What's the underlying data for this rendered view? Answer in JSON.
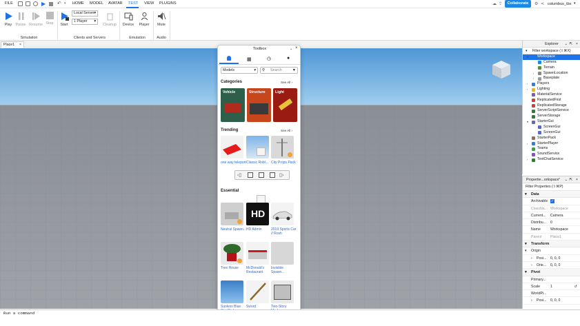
{
  "menu": {
    "file": "FILE",
    "home": "HOME",
    "model": "MODEL",
    "avatar": "AVATAR",
    "test": "TEST",
    "view": "VIEW",
    "plugins": "PLUGINS"
  },
  "topright": {
    "collaborate": "Collaborate",
    "user": "columbus_tbx"
  },
  "ribbon": {
    "play": "Play",
    "pause": "Pause",
    "resume": "Resume",
    "stop": "Stop",
    "group_simulation": "Simulation",
    "start": "Start",
    "server_select": "Local Server",
    "players_select": "1 Player",
    "cleanup": "Cleanup",
    "group_clients": "Clients and Servers",
    "device": "Device",
    "player": "Player",
    "group_emulation": "Emulation",
    "mute": "Mute",
    "group_audio": "Audio"
  },
  "doc_tab": "Place1",
  "command_bar": "Run a command",
  "toolbox": {
    "title": "Toolbox",
    "category_select": "Models",
    "search_placeholder": "Search",
    "categories": {
      "title": "Categories",
      "see_all": "See All",
      "items": [
        {
          "label": "Vehicle",
          "color": "#2e5f4a"
        },
        {
          "label": "Structure",
          "color": "#c8461c"
        },
        {
          "label": "Light",
          "color": "#9a1b12"
        }
      ]
    },
    "trending": {
      "title": "Trending",
      "see_all": "See All",
      "items": [
        {
          "label": "one way teleport"
        },
        {
          "label": "Classic Robl..."
        },
        {
          "label": "City Props Pack"
        }
      ]
    },
    "essential": {
      "title": "Essential",
      "items": [
        {
          "label": "Neutral Spawn..."
        },
        {
          "label": "HD Admin"
        },
        {
          "label": "2019 Sports Car // Rosh"
        },
        {
          "label": "Tree House"
        },
        {
          "label": "McDonald's Restaurant"
        },
        {
          "label": "Invisible Spawn..."
        },
        {
          "label": "Sunless Blue Sky Skybox"
        },
        {
          "label": "Sword"
        },
        {
          "label": "Two-Story Modern..."
        }
      ]
    }
  },
  "explorer": {
    "title": "Explorer",
    "filter": "Filter workspace (⇧⌘X)",
    "items": [
      {
        "label": "Workspace",
        "selected": true
      },
      {
        "label": "Camera"
      },
      {
        "label": "Terrain"
      },
      {
        "label": "SpawnLocation"
      },
      {
        "label": "Baseplate"
      },
      {
        "label": "Players"
      },
      {
        "label": "Lighting"
      },
      {
        "label": "MaterialService"
      },
      {
        "label": "ReplicatedFirst"
      },
      {
        "label": "ReplicatedStorage"
      },
      {
        "label": "ServerScriptService"
      },
      {
        "label": "ServerStorage"
      },
      {
        "label": "StarterGui"
      },
      {
        "label": "ScreenGui"
      },
      {
        "label": "ScreenGui"
      },
      {
        "label": "StarterPack"
      },
      {
        "label": "StarterPlayer"
      },
      {
        "label": "Teams"
      },
      {
        "label": "SoundService"
      },
      {
        "label": "TextChatService"
      }
    ]
  },
  "properties": {
    "title": "Propertie...orkspace\"",
    "filter": "Filter Properties (⇧⌘P)",
    "cat_data": "Data",
    "rows_data": [
      {
        "name": "Archivable",
        "value": "✓"
      },
      {
        "name": "ClassNa...",
        "value": "Workspace"
      },
      {
        "name": "Current...",
        "value": "Camera"
      },
      {
        "name": "Distribu...",
        "value": "0"
      },
      {
        "name": "Name",
        "value": "Workspace"
      },
      {
        "name": "Parent",
        "value": "Place1"
      }
    ],
    "cat_transform": "Transform",
    "origin": "Origin",
    "rows_transform": [
      {
        "name": "Posi...",
        "value": "0, 0, 0"
      },
      {
        "name": "Orie...",
        "value": "0, 0, 0"
      }
    ],
    "cat_pivot": "Pivot",
    "rows_pivot": [
      {
        "name": "Primary...",
        "value": ""
      },
      {
        "name": "Scale",
        "value": "1"
      },
      {
        "name": "WorldPi...",
        "value": ""
      },
      {
        "name": "Posi...",
        "value": "0, 0, 0"
      }
    ]
  }
}
